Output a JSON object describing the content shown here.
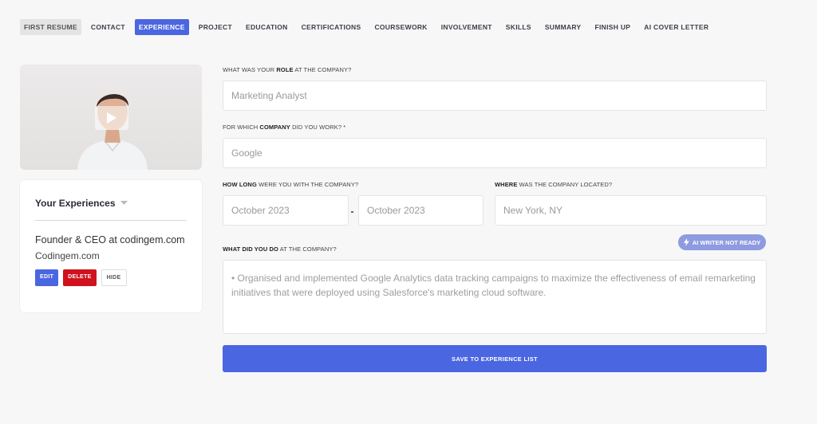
{
  "nav": {
    "items": [
      {
        "label": "FIRST RESUME",
        "state": "done"
      },
      {
        "label": "CONTACT",
        "state": "default"
      },
      {
        "label": "EXPERIENCE",
        "state": "active"
      },
      {
        "label": "PROJECT",
        "state": "default"
      },
      {
        "label": "EDUCATION",
        "state": "default"
      },
      {
        "label": "CERTIFICATIONS",
        "state": "default"
      },
      {
        "label": "COURSEWORK",
        "state": "default"
      },
      {
        "label": "INVOLVEMENT",
        "state": "default"
      },
      {
        "label": "SKILLS",
        "state": "default"
      },
      {
        "label": "SUMMARY",
        "state": "default"
      },
      {
        "label": "FINISH UP",
        "state": "default"
      },
      {
        "label": "AI COVER LETTER",
        "state": "default"
      }
    ]
  },
  "experiences": {
    "header": "Your Experiences",
    "entry": {
      "title": "Founder & CEO at codingem.com",
      "company": "Codingem.com",
      "edit_label": "EDIT",
      "delete_label": "DELETE",
      "hide_label": "HIDE"
    }
  },
  "form": {
    "role": {
      "label_pre": "WHAT WAS YOUR ",
      "label_bold": "ROLE",
      "label_post": " AT THE COMPANY?",
      "placeholder": "Marketing Analyst"
    },
    "company": {
      "label_pre": "FOR WHICH ",
      "label_bold": "COMPANY",
      "label_post": " DID YOU WORK?  *",
      "placeholder": "Google"
    },
    "duration": {
      "label_bold": "HOW LONG",
      "label_post": " WERE YOU WITH THE COMPANY?",
      "start_placeholder": "October 2023",
      "end_placeholder": "October 2023"
    },
    "location": {
      "label_bold": "WHERE",
      "label_post": " WAS THE COMPANY LOCATED?",
      "placeholder": "New York, NY"
    },
    "duties": {
      "label_bold": "WHAT DID YOU DO",
      "label_post": " AT THE COMPANY?",
      "placeholder": "• Organised and implemented Google Analytics data tracking campaigns to maximize the effectiveness of email remarketing initiatives that were deployed using Salesforce's marketing cloud software."
    },
    "ai_writer_label": "AI WRITER NOT READY",
    "save_label": "SAVE TO EXPERIENCE LIST"
  },
  "colors": {
    "accent": "#4a66e0",
    "danger": "#d0121e",
    "ai_badge": "#8e9be0"
  }
}
